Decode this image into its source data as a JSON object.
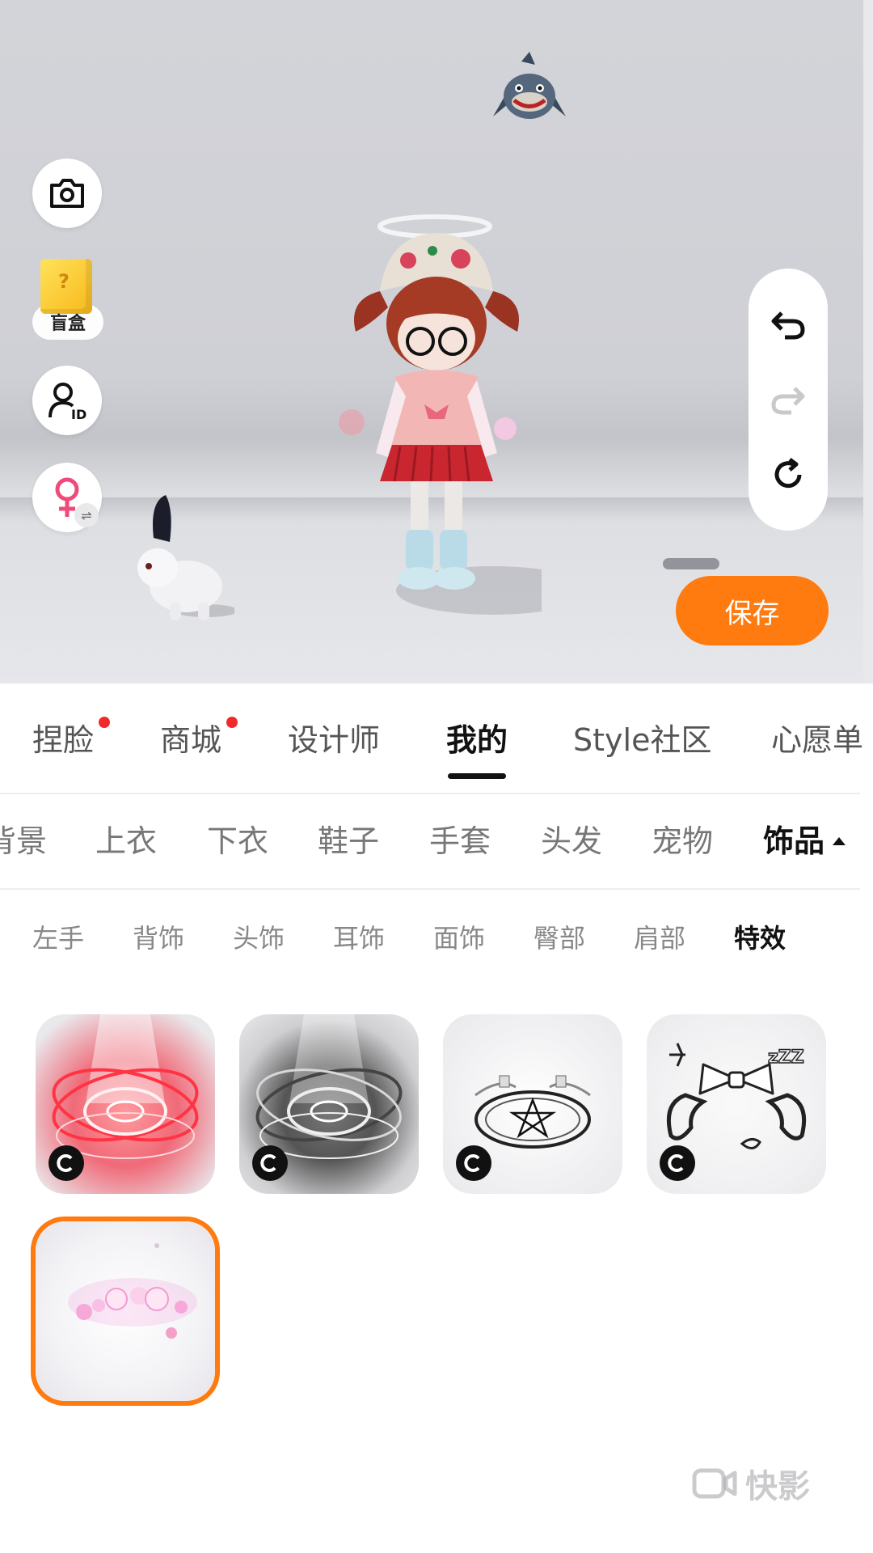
{
  "toolbar": {
    "camera_icon": "camera-icon",
    "blindbox_label": "盲盒",
    "id_icon": "user-id-icon",
    "gender_icon": "female-swap-icon"
  },
  "history": {
    "undo_icon": "undo-icon",
    "redo_icon": "redo-icon",
    "reset_icon": "reset-icon"
  },
  "save_label": "保存",
  "main_tabs": [
    {
      "label": "捏脸",
      "dot": true
    },
    {
      "label": "商城",
      "dot": true
    },
    {
      "label": "设计师",
      "dot": false
    },
    {
      "label": "我的",
      "dot": false,
      "active": true
    },
    {
      "label": "Style社区",
      "dot": false
    },
    {
      "label": "心愿单",
      "dot": false
    }
  ],
  "category_tabs": [
    "背景",
    "上衣",
    "下衣",
    "鞋子",
    "手套",
    "头发",
    "宠物",
    "饰品"
  ],
  "active_category": "饰品",
  "sub_tabs": [
    "左手",
    "背饰",
    "头饰",
    "耳饰",
    "面饰",
    "臀部",
    "肩部",
    "特效"
  ],
  "active_sub_tab": "特效",
  "items": [
    {
      "name": "red-magic-circle-effect",
      "badge": "C"
    },
    {
      "name": "black-magic-circle-effect",
      "badge": "C"
    },
    {
      "name": "pentagram-circle-effect",
      "badge": "C"
    },
    {
      "name": "bow-sleep-effect",
      "badge": "C"
    },
    {
      "name": "pink-bubbles-effect",
      "selected": true
    }
  ],
  "watermark": "快影",
  "colors": {
    "accent": "#ff7a0f",
    "dot": "#f02a2a",
    "active_text": "#111111"
  }
}
